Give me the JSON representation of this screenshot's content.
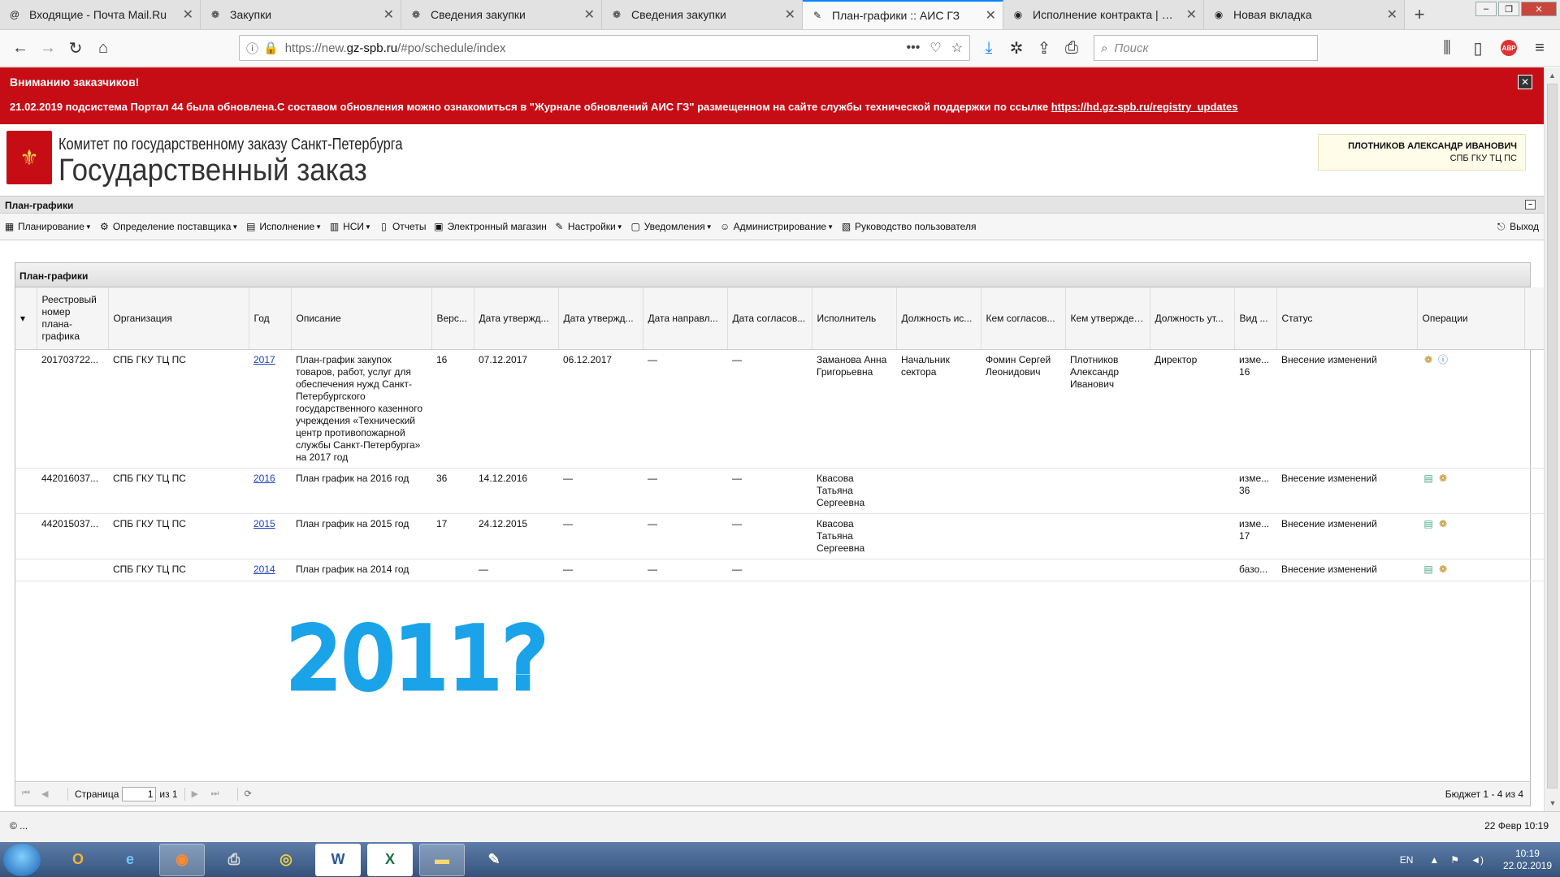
{
  "browser": {
    "tabs": [
      {
        "title": "Входящие - Почта Mail.Ru",
        "icon": "@"
      },
      {
        "title": "Закупки",
        "icon": "❁"
      },
      {
        "title": "Сведения закупки",
        "icon": "❁"
      },
      {
        "title": "Сведения закупки",
        "icon": "❁"
      },
      {
        "title": "План-графики :: АИС ГЗ",
        "icon": "✎"
      },
      {
        "title": "Исполнение контракта | HelpDesk",
        "icon": "◉"
      },
      {
        "title": "Новая вкладка",
        "icon": "◉"
      }
    ],
    "new_tab": "+",
    "url_prefix": "https://new.",
    "url_domain": "gz-spb.ru",
    "url_path": "/#po/schedule/index",
    "search_placeholder": "Поиск",
    "abp": "ABP"
  },
  "banner": {
    "title": "Вниманию заказчиков!",
    "message": "21.02.2019 подсистема Портал 44 была обновлена.С составом обновления можно ознакомиться в \"Журнале обновлений АИС ГЗ\" размещенном на сайте службы технической поддержки по ссылке ",
    "link": "https://hd.gz-spb.ru/registry_updates",
    "close": "✕"
  },
  "header": {
    "org_line1": "Комитет по государственному заказу Санкт-Петербурга",
    "org_line2": "Государственный заказ",
    "user_name": "ПЛОТНИКОВ АЛЕКСАНДР ИВАНОВИЧ",
    "user_dept": "СПБ ГКУ ТЦ ПС"
  },
  "section_title": "План-графики",
  "menu": [
    {
      "label": "Планирование",
      "icon": "▦",
      "dropdown": true
    },
    {
      "label": "Определение поставщика",
      "icon": "⚙",
      "dropdown": true
    },
    {
      "label": "Исполнение",
      "icon": "▤",
      "dropdown": true
    },
    {
      "label": "НСИ",
      "icon": "▥",
      "dropdown": true
    },
    {
      "label": "Отчеты",
      "icon": "▯",
      "dropdown": false
    },
    {
      "label": "Электронный магазин",
      "icon": "▣",
      "dropdown": false
    },
    {
      "label": "Настройки",
      "icon": "✎",
      "dropdown": true
    },
    {
      "label": "Уведомления",
      "icon": "▢",
      "dropdown": true
    },
    {
      "label": "Администрирование",
      "icon": "☺",
      "dropdown": true
    },
    {
      "label": "Руководство пользователя",
      "icon": "▧",
      "dropdown": false
    }
  ],
  "logout": "Выход",
  "grid": {
    "title": "План-графики",
    "columns": [
      "Реестровый номер плана-графика",
      "Организация",
      "Год",
      "Описание",
      "Верс...",
      "Дата утвержд...",
      "Дата утвержд...",
      "Дата направл...",
      "Дата согласов...",
      "Исполнитель",
      "Должность ис...",
      "Кем согласов...",
      "Кем утверждено",
      "Должность ут...",
      "Вид ...",
      "Статус",
      "Операции"
    ],
    "rows": [
      {
        "reg": "201703722...",
        "org": "СПБ ГКУ ТЦ ПС",
        "year": "2017",
        "desc": "План-график закупок товаров, работ, услуг для обеспечения нужд Санкт-Петербургского государственного казенного учреждения «Технический центр противопожарной службы Санкт-Петербурга» на 2017 год",
        "ver": "16",
        "d1": "07.12.2017",
        "d2": "06.12.2017",
        "d3": "—",
        "d4": "—",
        "exec": "Заманова Анна Григорьевна",
        "exec_pos": "Начальник сектора",
        "agreed": "Фомин Сергей Леонидович",
        "approved": "Плотников Александр Иванович",
        "appr_pos": "Директор",
        "kind": "изме... 16",
        "status": "Внесение изменений"
      },
      {
        "reg": "442016037...",
        "org": "СПБ ГКУ ТЦ ПС",
        "year": "2016",
        "desc": "План график на 2016 год",
        "ver": "36",
        "d1": "14.12.2016",
        "d2": "—",
        "d3": "—",
        "d4": "—",
        "exec": "Квасова Татьяна Сергеевна",
        "exec_pos": "",
        "agreed": "",
        "approved": "",
        "appr_pos": "",
        "kind": "изме... 36",
        "status": "Внесение изменений"
      },
      {
        "reg": "442015037...",
        "org": "СПБ ГКУ ТЦ ПС",
        "year": "2015",
        "desc": "План график на 2015 год",
        "ver": "17",
        "d1": "24.12.2015",
        "d2": "—",
        "d3": "—",
        "d4": "—",
        "exec": "Квасова Татьяна Сергеевна",
        "exec_pos": "",
        "agreed": "",
        "approved": "",
        "appr_pos": "",
        "kind": "изме... 17",
        "status": "Внесение изменений"
      },
      {
        "reg": "",
        "org": "СПБ ГКУ ТЦ ПС",
        "year": "2014",
        "desc": "План график на 2014 год",
        "ver": "",
        "d1": "—",
        "d2": "—",
        "d3": "—",
        "d4": "—",
        "exec": "",
        "exec_pos": "",
        "agreed": "",
        "approved": "",
        "appr_pos": "",
        "kind": "базо...",
        "status": "Внесение изменений"
      }
    ]
  },
  "pager": {
    "page_label": "Страница",
    "page_value": "1",
    "of_label": "из 1",
    "count": "Бюджет 1 - 4 из 4"
  },
  "annotation": "2011?",
  "annotation_color": "#1aa3e8",
  "statusbar": {
    "left": "© ...",
    "right": "22 Февр 10:19"
  },
  "taskbar": {
    "lang": "EN",
    "time": "10:19",
    "date": "22.02.2019"
  }
}
